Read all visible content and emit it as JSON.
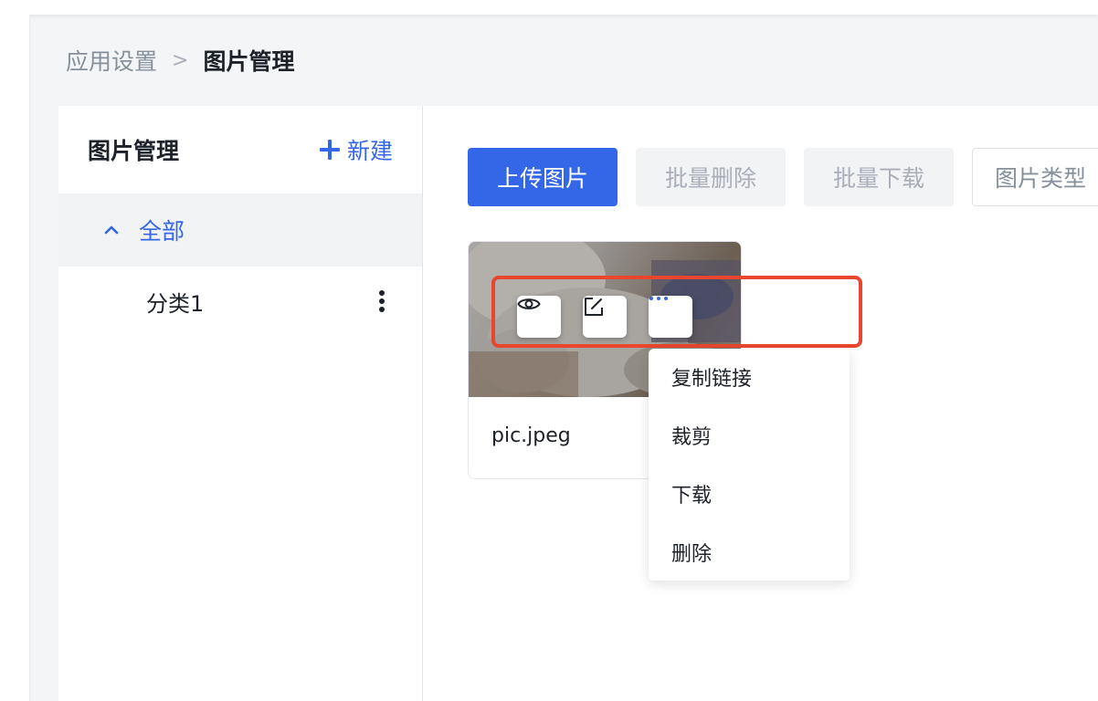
{
  "breadcrumb": {
    "parent": "应用设置",
    "separator": ">",
    "current": "图片管理"
  },
  "sidebar": {
    "title": "图片管理",
    "new_label": "新建",
    "tree": {
      "root_label": "全部",
      "children": [
        {
          "label": "分类1"
        }
      ]
    }
  },
  "toolbar": {
    "upload_label": "上传图片",
    "batch_delete_label": "批量删除",
    "batch_download_label": "批量下载",
    "type_filter_label": "图片类型"
  },
  "images": [
    {
      "name": "pic.jpeg"
    }
  ],
  "more_menu": {
    "items": [
      "复制链接",
      "裁剪",
      "下载",
      "删除"
    ]
  },
  "colors": {
    "primary": "#3467e8",
    "highlight": "#e8462f",
    "disabled_bg": "#f2f3f5"
  },
  "icons": {
    "view": "eye-icon",
    "edit": "edit-icon",
    "more": "more-horizontal-icon",
    "add": "plus-icon",
    "collapse": "chevron-up-icon",
    "options": "more-vertical-icon"
  }
}
